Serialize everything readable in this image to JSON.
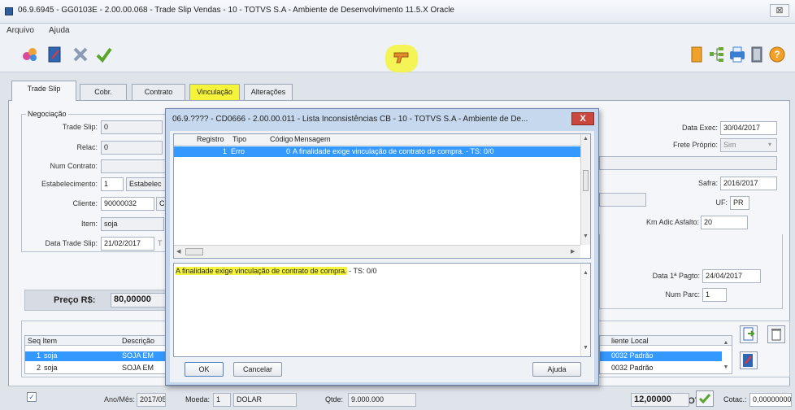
{
  "window": {
    "title": "06.9.6945 - GG0103E - 2.00.00.068 - Trade Slip Vendas - 10 - TOTVS S.A - Ambiente de Desenvolvimento 11.5.X Oracle",
    "close_glyph": "⊠"
  },
  "menu": {
    "items": [
      "Arquivo",
      "Ajuda"
    ]
  },
  "tabs": [
    "Trade Slip",
    "Cobr.",
    "Contrato",
    "Vinculação",
    "Alterações"
  ],
  "negociacao": {
    "group_label": "Negociação",
    "trade_slip_label": "Trade Slip:",
    "trade_slip_value": "0",
    "relac_label": "Relac:",
    "relac_value": "0",
    "num_contrato_label": "Num Contrato:",
    "estabelecimento_label": "Estabelecimento:",
    "estabelecimento_value": "1",
    "estabelec_partial": "Estabelec",
    "cliente_label": "Cliente:",
    "cliente_value": "90000032",
    "cliente_partial": "CC",
    "item_label": "Item:",
    "item_value": "soja",
    "data_trade_slip_label": "Data Trade Slip:",
    "data_trade_slip_value": "21/02/2017",
    "data_partial": "T"
  },
  "right_fields": {
    "data_exec_label": "Data Exec:",
    "data_exec_value": "30/04/2017",
    "frete_label": "Frete Próprio:",
    "frete_value": "Sim",
    "safra_label": "Safra:",
    "safra_value": "2016/2017",
    "uf_label": "UF:",
    "uf_value": "PR",
    "km_label": "Km Adic Asfalto:",
    "km_value": "20",
    "data_pagto_label": "Data 1ª Pagto:",
    "data_pagto_value": "24/04/2017",
    "num_parc_label": "Num Parc:",
    "num_parc_value": "1"
  },
  "preco": {
    "label": "Preço R$:",
    "value": "80,00000"
  },
  "items_grid": {
    "headers": [
      "Seq Item",
      "Descrição"
    ],
    "rows": [
      {
        "seq": "1",
        "item": "soja",
        "desc": "SOJA EM"
      },
      {
        "seq": "2",
        "item": "soja",
        "desc": "SOJA EM"
      }
    ],
    "right_header": "liente Local",
    "right_rows": [
      "0032 Padrão",
      "0032 Padrão"
    ]
  },
  "bottom": {
    "checkbox": "✓",
    "ano_mes_label": "Ano/Mês:",
    "ano_mes_value": "2017/05",
    "moeda_label": "Moeda:",
    "moeda_code": "1",
    "moeda_name": "DOLAR",
    "qtde_label": "Qtde:",
    "qtde_value": "9.000.000",
    "cbot_label": "CBOT:",
    "cbot_value": "12,00000",
    "cotac_label": "Cotac.:",
    "cotac_value": "0,00000000"
  },
  "dialog": {
    "title": "06.9.???? - CD0666 - 2.00.00.011 - Lista Inconsistências CB - 10 - TOTVS S.A - Ambiente de De...",
    "close_glyph": "X",
    "headers": {
      "registro": "Registro",
      "tipo": "Tipo",
      "codigo": "Código",
      "mensagem": "Mensagem"
    },
    "row": {
      "registro": "1",
      "tipo": "Erro",
      "codigo": "0",
      "mensagem": "A finalidade exige vinculação de contrato de compra. - TS: 0/0"
    },
    "detail_highlight": "A finalidade exige vinculação de contrato de compra.",
    "detail_rest": " - TS: 0/0",
    "ok": "OK",
    "cancel": "Cancelar",
    "help": "Ajuda"
  },
  "icons": {
    "toolbar_left": [
      "settings-cluster-icon",
      "edit-document-icon",
      "delete-icon",
      "confirm-check-icon"
    ],
    "toolbar_center": "gun-icon",
    "toolbar_right": [
      "bookmark-icon",
      "tree-icon",
      "print-icon",
      "exit-door-icon",
      "help-icon"
    ]
  },
  "colors": {
    "highlight": "#f6f43a",
    "selection": "#3399ff",
    "dialog_frame": "#c6d8ee",
    "close_red": "#c9473c"
  }
}
